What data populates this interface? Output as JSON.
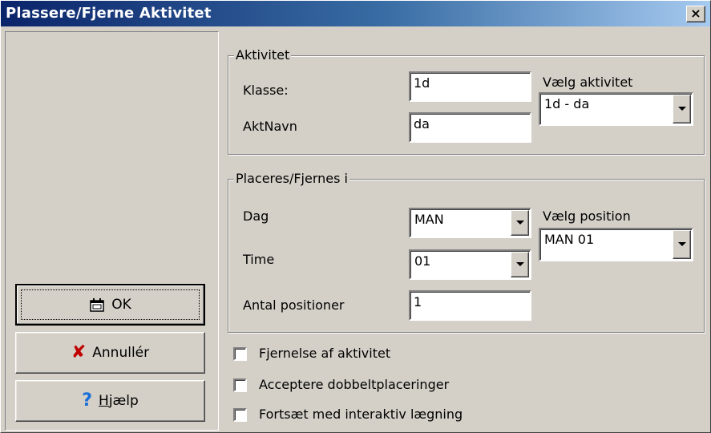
{
  "window": {
    "title": "Plassere/Fjerne Aktivitet",
    "close_glyph": "×"
  },
  "buttons": {
    "ok": "OK",
    "cancel": "Annullér",
    "help_prefix": "H",
    "help_rest": "jælp"
  },
  "aktivitet": {
    "legend": "Aktivitet",
    "klasse_label": "Klasse:",
    "klasse_value": "1d",
    "aktnavn_label": "AktNavn",
    "aktnavn_value": "da",
    "vaelg_label": "Vælg aktivitet",
    "vaelg_value": "1d - da"
  },
  "placeres": {
    "legend": "Placeres/Fjernes i",
    "dag_label": "Dag",
    "dag_value": "MAN",
    "time_label": "Time",
    "time_value": "01",
    "antal_label": "Antal positioner",
    "antal_value": "1",
    "vaelg_label": "Vælg position",
    "vaelg_value": "MAN 01"
  },
  "checkboxes": [
    {
      "label": "Fjernelse af aktivitet",
      "checked": false
    },
    {
      "label": "Acceptere dobbeltplaceringer",
      "checked": false
    },
    {
      "label": "Fortsæt med interaktiv lægning",
      "checked": false
    }
  ],
  "icons": {
    "ok": "schedule-ok-icon",
    "cancel": "red-x-icon",
    "help": "question-mark-icon"
  }
}
